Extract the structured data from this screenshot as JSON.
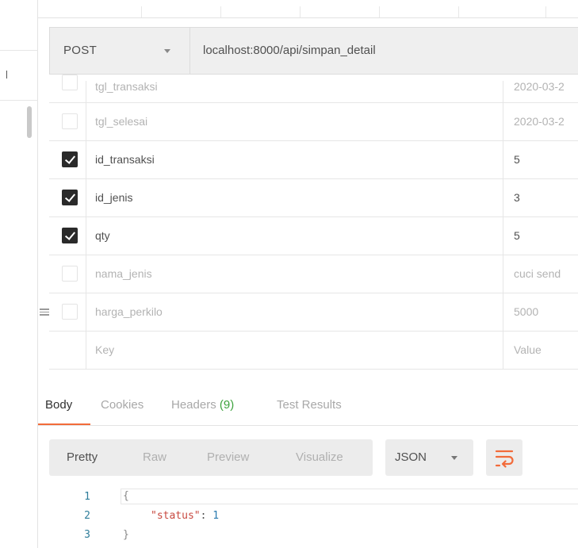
{
  "request": {
    "method": "POST",
    "url": "localhost:8000/api/simpan_detail"
  },
  "params": [
    {
      "key": "tgl_transaksi",
      "value": "2020-03-2",
      "checked": false
    },
    {
      "key": "tgl_selesai",
      "value": "2020-03-2",
      "checked": false
    },
    {
      "key": "id_transaksi",
      "value": "5",
      "checked": true
    },
    {
      "key": "id_jenis",
      "value": "3",
      "checked": true
    },
    {
      "key": "qty",
      "value": "5",
      "checked": true
    },
    {
      "key": "nama_jenis",
      "value": "cuci send",
      "checked": false
    },
    {
      "key": "harga_perkilo",
      "value": "5000",
      "checked": false
    }
  ],
  "params_placeholder": {
    "key": "Key",
    "value": "Value"
  },
  "response_tabs": {
    "body": "Body",
    "cookies": "Cookies",
    "headers": "Headers",
    "headers_count": "(9)",
    "test_results": "Test Results"
  },
  "format_options": [
    "Pretty",
    "Raw",
    "Preview",
    "Visualize"
  ],
  "language": "JSON",
  "code_lines": {
    "n1": "1",
    "n2": "2",
    "n3": "3",
    "open": "{",
    "key": "\"status\"",
    "colon": ": ",
    "value": "1",
    "close": "}"
  },
  "icons": {
    "method_dropdown": "chevron-down-icon",
    "wrap": "wrap-lines-icon",
    "drag": "drag-handle-icon",
    "check": "check-icon"
  },
  "colors": {
    "active_tab": "#f26b3a",
    "headers_count": "#3fa33f",
    "checkbox_checked": "#2a2a2a",
    "json_key": "#c8483f",
    "json_number": "#2a7ab0"
  }
}
